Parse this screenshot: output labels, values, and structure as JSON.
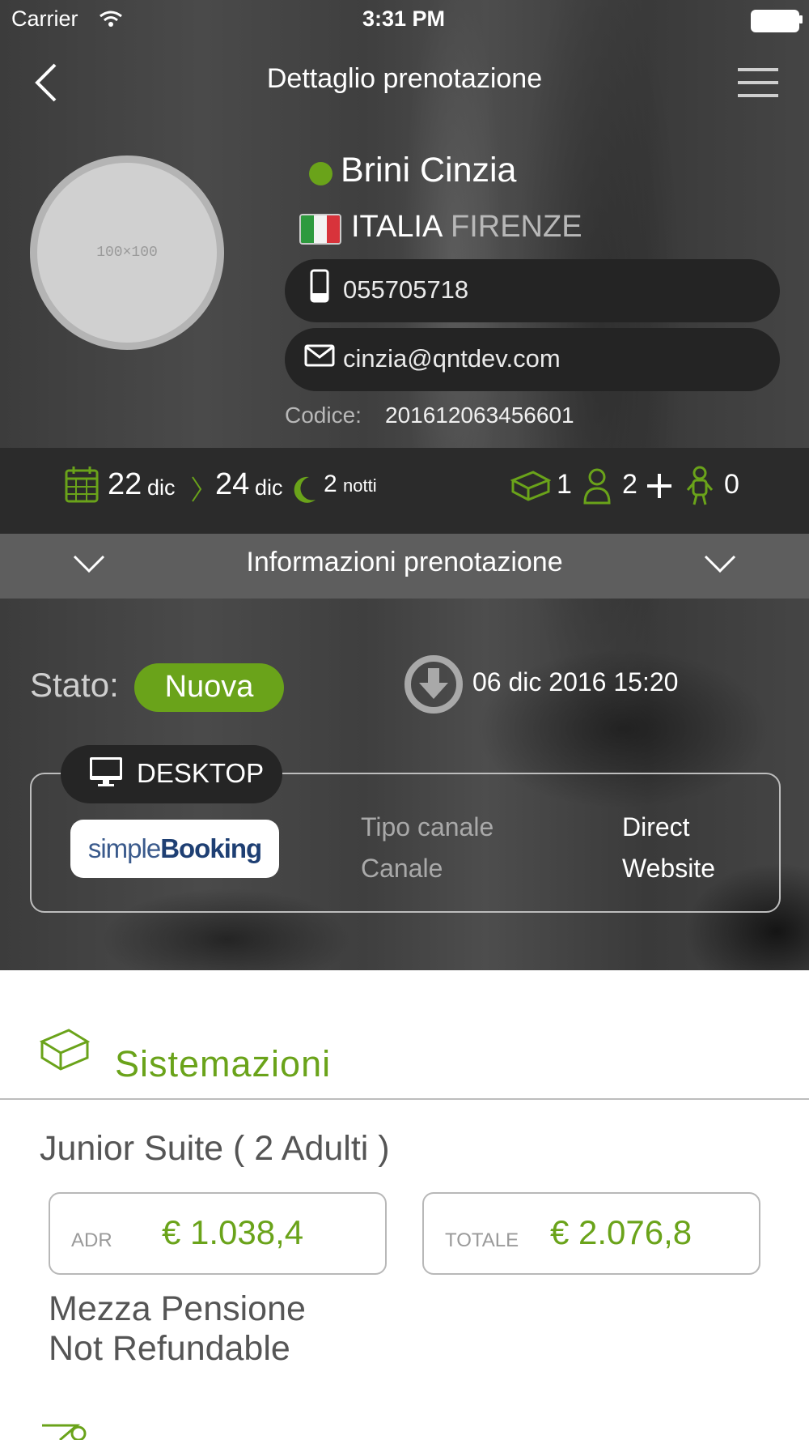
{
  "status_bar": {
    "carrier": "Carrier",
    "time": "3:31 PM"
  },
  "header": {
    "title": "Dettaglio prenotazione",
    "back_icon": "chevron-left-icon",
    "menu_icon": "hamburger-menu-icon"
  },
  "guest": {
    "avatar_placeholder": "100×100",
    "name": "Brini Cinzia",
    "status_dot_color": "#6aa31a",
    "country": "ITALIA",
    "city": "FIRENZE",
    "phone": "055705718",
    "email": "cinzia@qntdev.com",
    "code_label": "Codice:",
    "code_value": "201612063456601"
  },
  "stay": {
    "checkin_day": "22",
    "checkin_month": "dic",
    "checkout_day": "24",
    "checkout_month": "dic",
    "nights_count": "2",
    "nights_label": "notti",
    "rooms": "1",
    "adults": "2",
    "children": "0"
  },
  "info_bar": {
    "label": "Informazioni prenotazione"
  },
  "booking": {
    "status_label": "Stato:",
    "status_value": "Nuova",
    "download_datetime": "06 dic 2016 15:20",
    "device_label": "DESKTOP",
    "logo_text_simple": "simple",
    "logo_text_booking": "Booking",
    "channel_type_label": "Tipo canale",
    "channel_type_value": "Direct",
    "channel_label": "Canale",
    "channel_value": "Website"
  },
  "accommodations": {
    "section_title": "Sistemazioni",
    "room_name": "Junior Suite ( 2 Adulti )",
    "adr_label": "ADR",
    "adr_value": "€ 1.038,4",
    "total_label": "TOTALE",
    "total_value": "€ 2.076,8",
    "board": "Mezza Pensione",
    "policy": "Not Refundable"
  },
  "colors": {
    "accent": "#6aa31a",
    "dark_band": "#2b2b2b",
    "pill": "#242424"
  }
}
